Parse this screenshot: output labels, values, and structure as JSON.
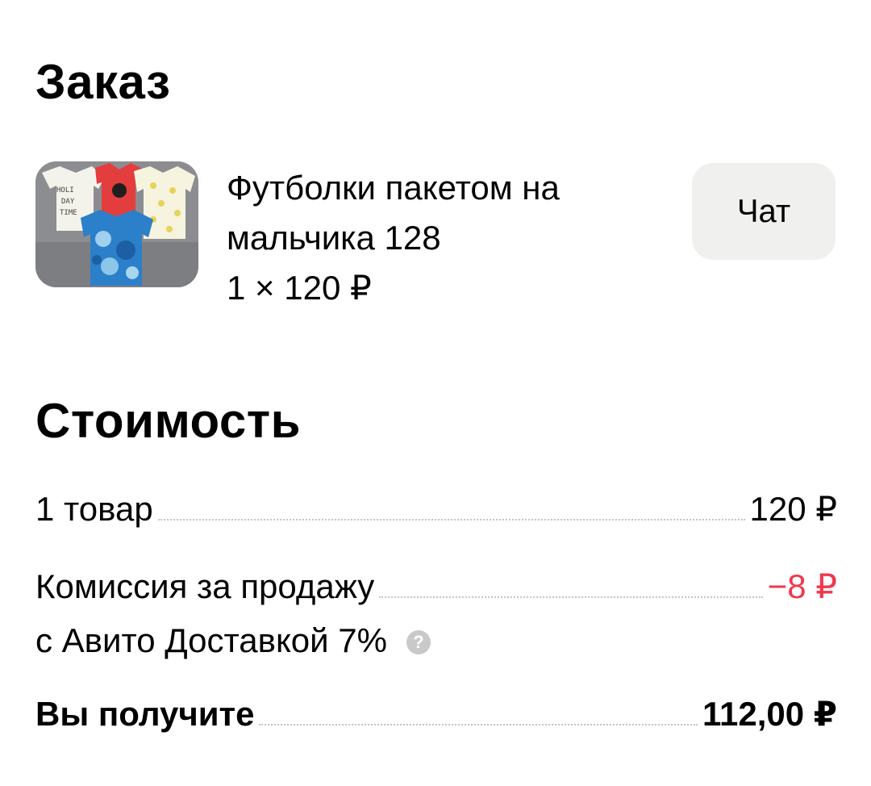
{
  "order": {
    "title": "Заказ",
    "item": {
      "name": "Футболки пакетом на мальчика 128",
      "quantity_price": "1 × 120 ₽",
      "image_text": "HOLI DAY TIME"
    },
    "chat_label": "Чат"
  },
  "cost": {
    "title": "Стоимость",
    "rows": [
      {
        "label": "1 товар",
        "value": "120 ₽"
      },
      {
        "label": "Комиссия за продажу",
        "label_line2": "с Авито Доставкой 7%",
        "value": "−8 ₽"
      }
    ],
    "total": {
      "label": "Вы получите",
      "value": "112,00 ₽"
    },
    "help_icon": "?"
  },
  "colors": {
    "negative": "#f2374d",
    "button_bg": "#f0f0ef"
  }
}
